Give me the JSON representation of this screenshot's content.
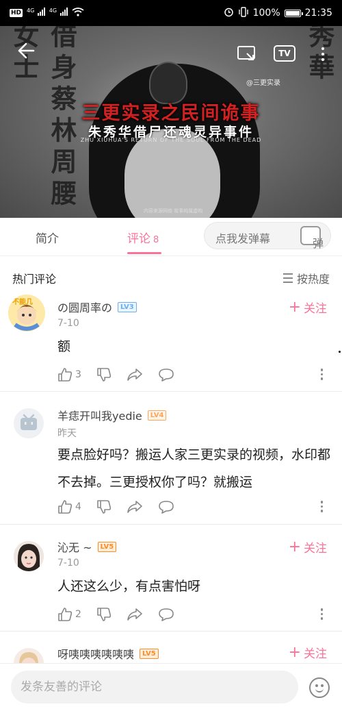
{
  "status_bar": {
    "hd": "HD",
    "net1": "4G",
    "net2": "4G",
    "battery": "100%",
    "battery_level": 1.0,
    "time": "21:35"
  },
  "video": {
    "couplet_left": "借身蔡林周腰女士",
    "couplet_right": "還魂是金門朱秀華",
    "title_cn": "三更实录之民间诡事",
    "subtitle_cn": "朱秀华借尸还魂灵异事件",
    "title_en": "ZHU XIUHUA'S RETURN OF THE SOUL FROM THE DEAD",
    "watermark": "@三更实录",
    "caption": "内容来源网络 故事纯属虚构",
    "tv_label": "TV"
  },
  "tabs": {
    "intro": "简介",
    "comments": "评论",
    "comments_count": "8",
    "danmaku_placeholder": "点我发弹幕",
    "danmaku_button": "弹"
  },
  "hot": {
    "title": "热门评论",
    "sort": "按热度"
  },
  "comments": [
    {
      "username": "の圆周率の",
      "level": "LV3",
      "date": "7-10",
      "text": "额",
      "likes": "3",
      "follow": "关注",
      "avatar_text": "不能几"
    },
    {
      "username": "羊痣开叫我yedie",
      "level": "LV4",
      "date": "昨天",
      "text": "要点脸好吗？搬运人家三更实录的视频，水印都不去掉。三更授权你了吗？就搬运",
      "likes": "4",
      "follow": ""
    },
    {
      "username": "沁无 ~",
      "level": "LV5",
      "date": "7-10",
      "text": "人还这么少，有点害怕呀",
      "likes": "2",
      "follow": "关注"
    },
    {
      "username": "呀咦咦咦咦咦咦",
      "level": "LV5",
      "follow": "关注"
    }
  ],
  "bottom": {
    "placeholder": "发条友善的评论"
  },
  "colors": {
    "accent": "#fb7299",
    "text": "#212121",
    "muted": "#999999"
  }
}
